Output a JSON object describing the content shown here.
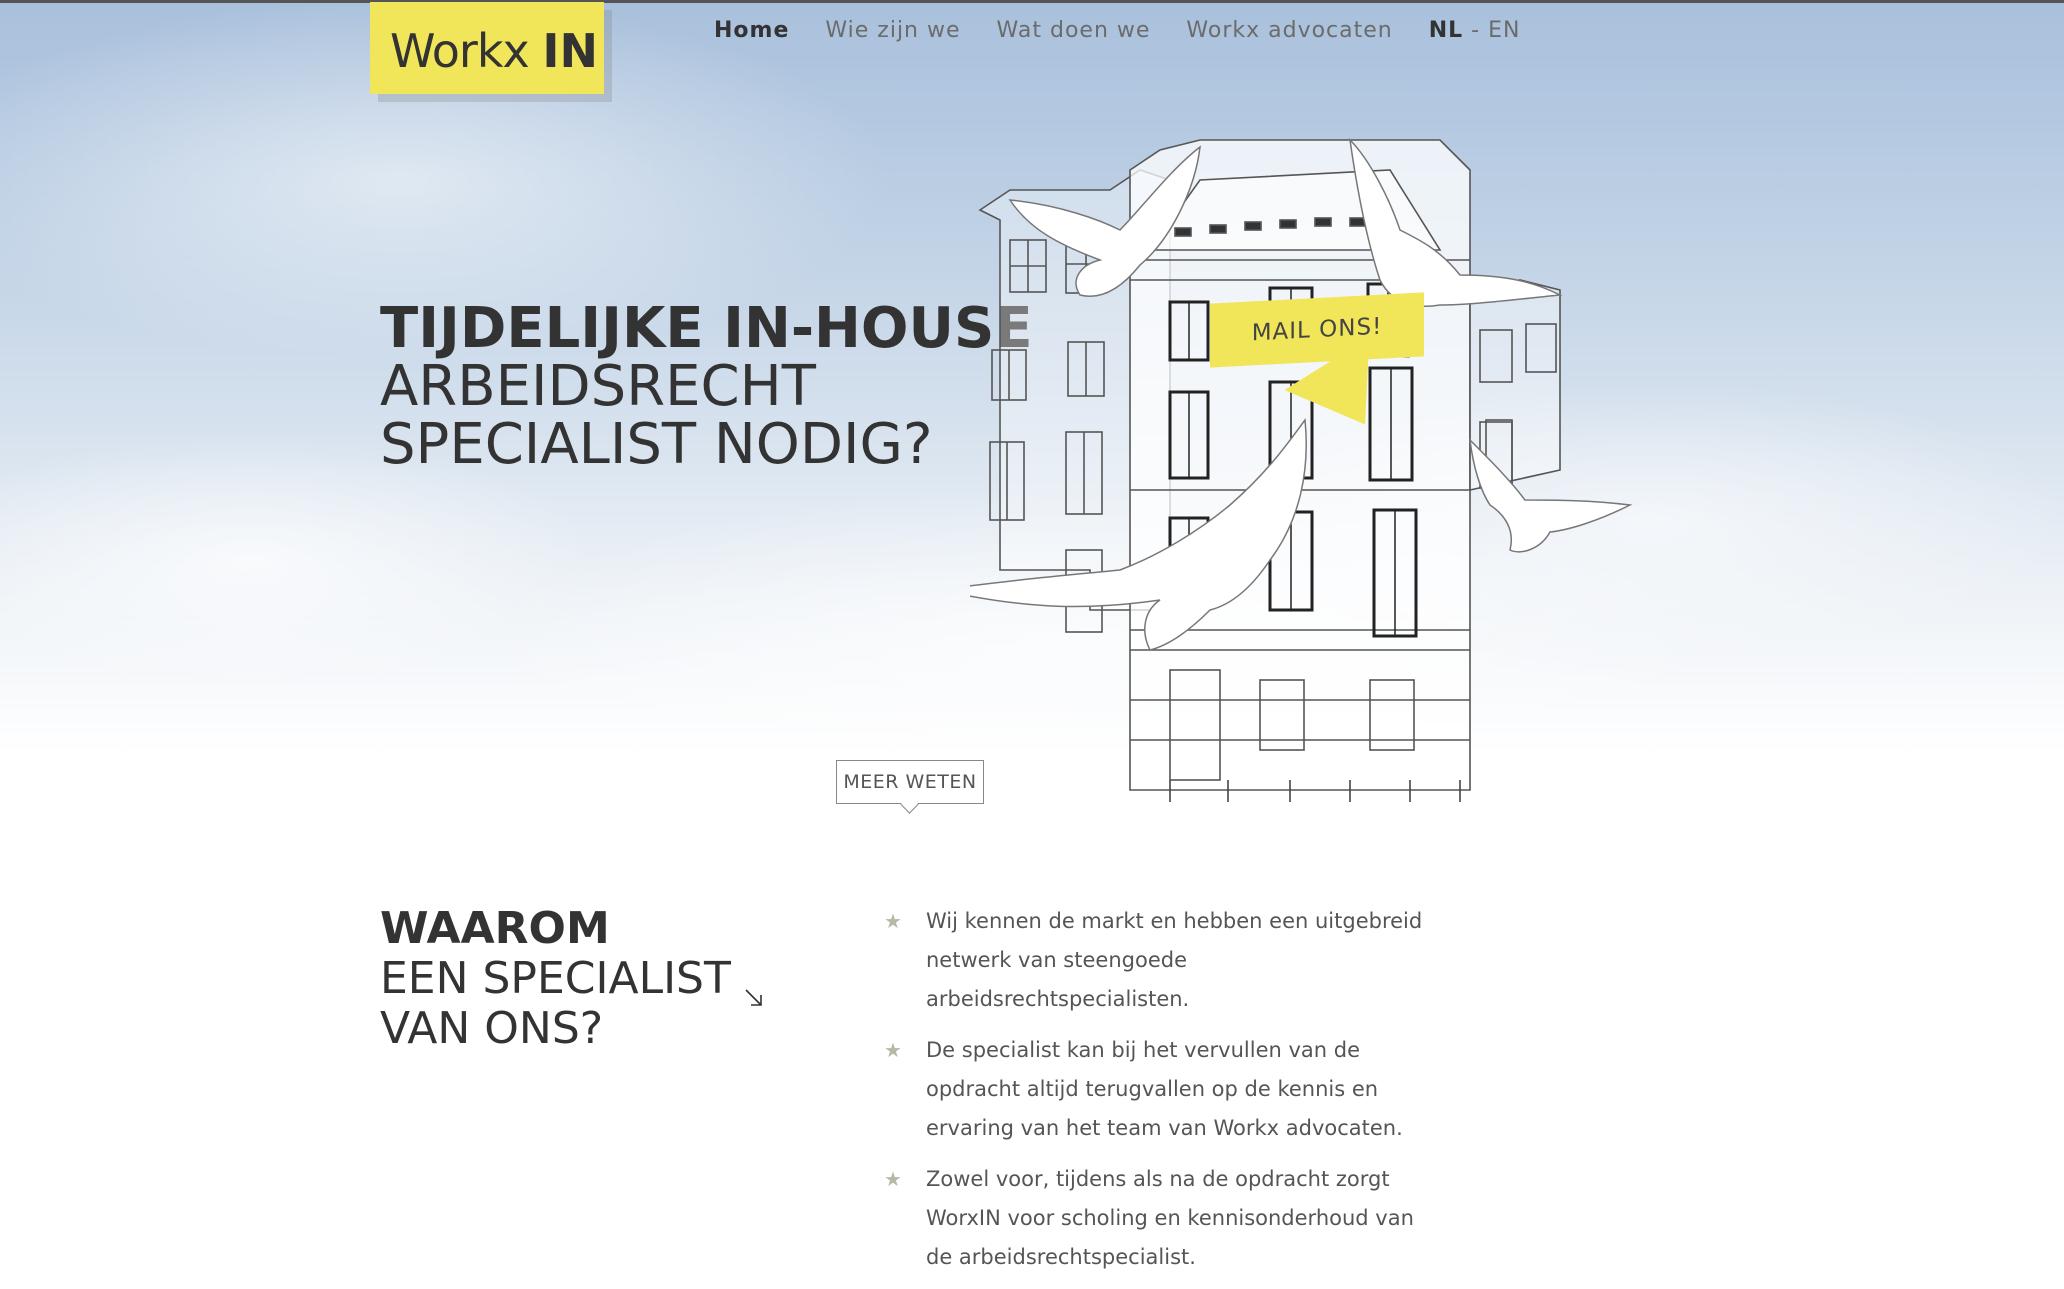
{
  "header": {
    "logo_regular": "Workx",
    "logo_bold": "IN"
  },
  "nav": {
    "items": [
      {
        "label": "Home",
        "active": true
      },
      {
        "label": "Wie zijn we",
        "active": false
      },
      {
        "label": "Wat doen we",
        "active": false
      },
      {
        "label": "Workx advocaten",
        "active": false
      }
    ],
    "lang_nl": "NL",
    "lang_sep": " - ",
    "lang_en": "EN"
  },
  "hero": {
    "title_bold": "TIJDELIJKE IN-HOUSE",
    "title_line2": "ARBEIDSRECHT",
    "title_line3": "SPECIALIST NODIG?",
    "mail_button": "MAIL ONS!",
    "more_button": "MEER WETEN"
  },
  "why": {
    "heading_bold": "WAAROM",
    "heading_line2": "EEN SPECIALIST",
    "heading_line3": "VAN ONS?",
    "reasons": [
      "Wij kennen de markt en hebben een uitgebreid netwerk van steengoede arbeidsrechtspecialisten.",
      "De specialist kan bij het vervullen van de opdracht altijd terugvallen op de kennis en ervaring van het team van Workx advocaten.",
      "Zowel voor, tijdens als na de opdracht zorgt WorxIN voor scholing en kennisonderhoud van de arbeidsrechtspecialist."
    ]
  },
  "icons": {
    "bullet": "star-icon",
    "arrow": "arrow-down-right-icon",
    "illustration": "building-with-birds-illustration"
  },
  "colors": {
    "accent_yellow": "#f1e65a",
    "text_dark": "#333333",
    "text_gray": "#6b6b6b",
    "sky_blue": "#a9c0dc"
  }
}
